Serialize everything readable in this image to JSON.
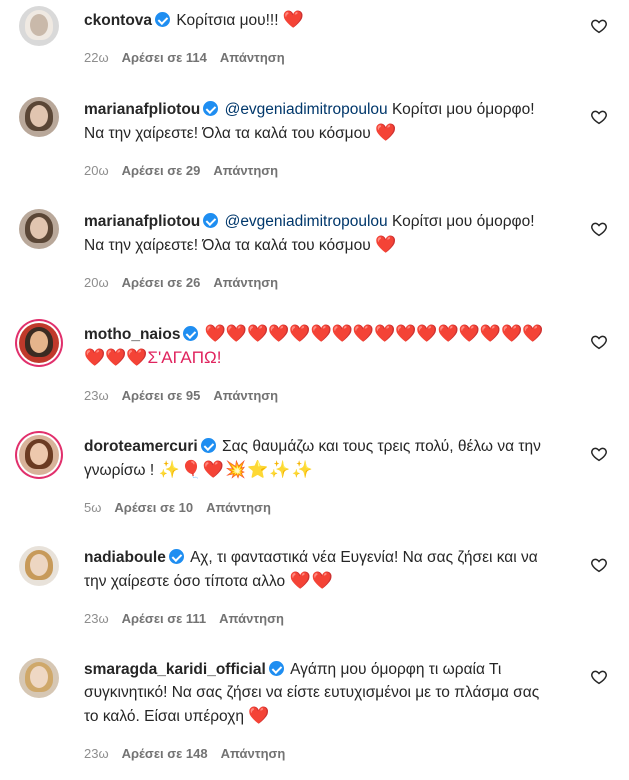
{
  "ui": {
    "reply_label": "Απάντηση"
  },
  "comments": [
    {
      "username": "ckontova",
      "verified": true,
      "mention": "",
      "text": "Κορίτσια μου!!!",
      "emoji": "❤️",
      "time": "22ω",
      "likes": "Αρέσει σε 114"
    },
    {
      "username": "marianafpliotou",
      "verified": true,
      "mention": "@evgeniadimitropoulou",
      "text": "Κορίτσι μου όμορφο! Να την χαίρεστε! Όλα τα καλά του κόσμου",
      "emoji": "❤️",
      "time": "20ω",
      "likes": "Αρέσει σε 29"
    },
    {
      "username": "marianafpliotou",
      "verified": true,
      "mention": "@evgeniadimitropoulou",
      "text": "Κορίτσι μου όμορφο! Να την χαίρεστε! Όλα τα καλά του κόσμου",
      "emoji": "❤️",
      "time": "20ω",
      "likes": "Αρέσει σε 26"
    },
    {
      "username": "motho_naios",
      "verified": true,
      "mention": "",
      "text": "❤️❤️❤️❤️❤️❤️❤️❤️❤️❤️❤️❤️❤️❤️❤️❤️❤️❤️❤️Σ'ΑΓΑΠΩ!",
      "emoji": "",
      "time": "23ω",
      "likes": "Αρέσει σε 95"
    },
    {
      "username": "doroteamercuri",
      "verified": true,
      "mention": "",
      "text": "Σας θαυμάζω και τους τρεις πολύ, θέλω να την γνωρίσω !",
      "emoji": "✨🎈❤️💥⭐✨✨",
      "time": "5ω",
      "likes": "Αρέσει σε 10"
    },
    {
      "username": "nadiaboule",
      "verified": true,
      "mention": "",
      "text": "Αχ, τι φανταστικά νέα Ευγενία! Να σας ζήσει και να την χαίρεστε όσο τίποτα αλλο",
      "emoji": "❤️❤️",
      "time": "23ω",
      "likes": "Αρέσει σε 111"
    },
    {
      "username": "smaragda_karidi_official",
      "verified": true,
      "mention": "",
      "text": "Αγάπη μου όμορφη τι ωραία Τι συγκινητικό! Να σας ζήσει να είστε ευτυχισμένοι με το πλάσμα σας το καλό. Είσαι υπέροχη",
      "emoji": "❤️",
      "time": "23ω",
      "likes": "Αρέσει σε 148"
    }
  ]
}
